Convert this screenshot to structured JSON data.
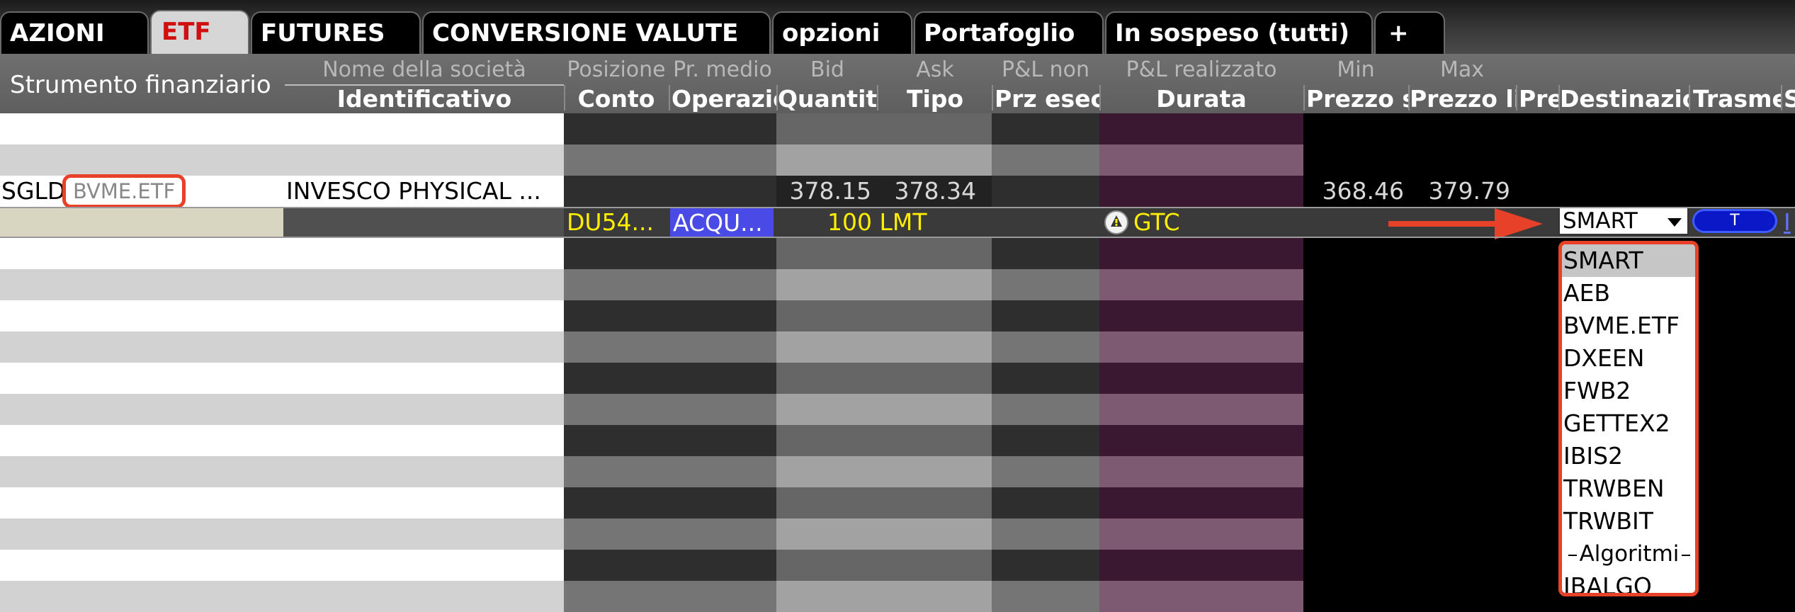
{
  "tabs": [
    {
      "label": "AZIONI",
      "active": false
    },
    {
      "label": "ETF",
      "active": true
    },
    {
      "label": "FUTURES",
      "active": false
    },
    {
      "label": "CONVERSIONE VALUTE",
      "active": false
    },
    {
      "label": "opzioni",
      "active": false
    },
    {
      "label": "Portafoglio",
      "active": false
    },
    {
      "label": "In sospeso (tutti)",
      "active": false
    },
    {
      "label": "+",
      "active": false
    }
  ],
  "header": {
    "instrument": "Strumento finanziario",
    "top": [
      "Nome della società",
      "Posizione",
      "Pr. medio",
      "Bid",
      "Ask",
      "P&L non",
      "P&L realizzato",
      "Min",
      "Max"
    ],
    "bottom": [
      "Identificativo",
      "Conto",
      "Operazione",
      "Quantità",
      "Tipo",
      "Prz esec",
      "Durata",
      "Prezzo stop",
      "Prezzo limite",
      "Prec",
      "Destinazione",
      "Trasmetti",
      "S"
    ]
  },
  "quote_row": {
    "symbol": "SGLD",
    "exchange_tag": "BVME.ETF",
    "company": "INVESCO PHYSICAL ...",
    "bid": "378.15",
    "ask": "378.34",
    "min": "368.46",
    "max": "379.79"
  },
  "order_row": {
    "account": "DU54...",
    "action": "ACQU...",
    "quantity_type": "100 LMT",
    "duration": "GTC",
    "destination": "SMART",
    "transmit": "T",
    "trailing": "I"
  },
  "dropdown": {
    "options": [
      "SMART",
      "AEB",
      "BVME.ETF",
      "DXEEN",
      "FWB2",
      "GETTEX2",
      "IBIS2",
      "TRWBEN",
      "TRWBIT"
    ],
    "selected": "SMART",
    "group_label": "Algoritmi",
    "algo_options": [
      "IBALGO"
    ]
  },
  "colors": {
    "accent_red": "#e8412a",
    "order_yellow": "#ffee00",
    "action_blue": "#4a4ae6",
    "durata_purple": "#3a1832"
  },
  "icons": {
    "duration_warning": "warning-bell-icon",
    "annotation_arrow": "arrow-right-icon"
  }
}
